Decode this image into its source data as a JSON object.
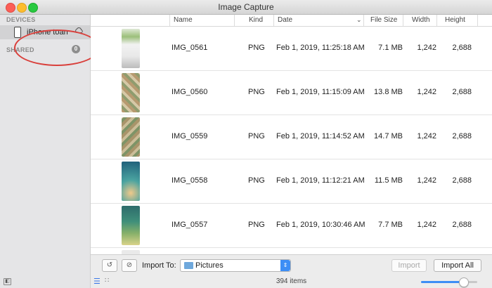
{
  "window": {
    "title": "Image Capture"
  },
  "sidebar": {
    "devices_heading": "DEVICES",
    "device_name": "iPhone toan",
    "shared_heading": "SHARED",
    "shared_count": "0"
  },
  "table": {
    "headers": {
      "name": "Name",
      "kind": "Kind",
      "date": "Date",
      "size": "File Size",
      "width": "Width",
      "height": "Height"
    },
    "sort_indicator": "⌄",
    "rows": [
      {
        "name": "IMG_0561",
        "kind": "PNG",
        "date": "Feb 1, 2019, 11:25:18 AM",
        "size": "7.1 MB",
        "width": "1,242",
        "height": "2,688"
      },
      {
        "name": "IMG_0560",
        "kind": "PNG",
        "date": "Feb 1, 2019, 11:15:09 AM",
        "size": "13.8 MB",
        "width": "1,242",
        "height": "2,688"
      },
      {
        "name": "IMG_0559",
        "kind": "PNG",
        "date": "Feb 1, 2019, 11:14:52 AM",
        "size": "14.7 MB",
        "width": "1,242",
        "height": "2,688"
      },
      {
        "name": "IMG_0558",
        "kind": "PNG",
        "date": "Feb 1, 2019, 11:12:21 AM",
        "size": "11.5 MB",
        "width": "1,242",
        "height": "2,688"
      },
      {
        "name": "IMG_0557",
        "kind": "PNG",
        "date": "Feb 1, 2019, 10:30:46 AM",
        "size": "7.7 MB",
        "width": "1,242",
        "height": "2,688"
      }
    ]
  },
  "importbar": {
    "rotate_icon": "rotate-left-icon",
    "delete_icon": "no-entry-icon",
    "import_to_label": "Import To:",
    "destination": "Pictures",
    "import_button": "Import",
    "import_all_button": "Import All"
  },
  "status": {
    "item_count": "394 items",
    "zoom_level": 0.75
  },
  "colors": {
    "accent": "#3d8ef5",
    "annotation": "#d9403c"
  }
}
